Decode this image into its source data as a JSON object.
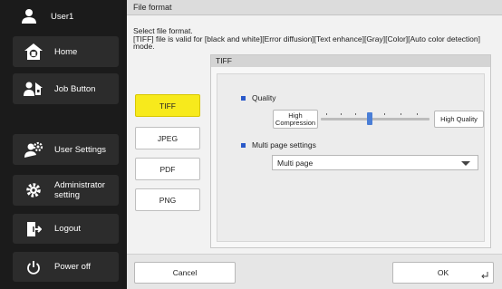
{
  "sidebar": {
    "user": "User1",
    "items": [
      {
        "label": "Home",
        "icon": "home-icon"
      },
      {
        "label": "Job Button",
        "icon": "job-button-icon"
      },
      {
        "label": "User Settings",
        "icon": "user-settings-icon"
      },
      {
        "label": "Administrator setting",
        "icon": "gear-icon"
      },
      {
        "label": "Logout",
        "icon": "logout-icon"
      },
      {
        "label": "Power off",
        "icon": "power-icon"
      }
    ]
  },
  "header": {
    "title": "File format"
  },
  "description": "Select file format.\n[TIFF] file is valid for [black and white][Error diffusion][Text enhance][Gray][Color][Auto color detection] mode.",
  "formats": {
    "options": [
      "TIFF",
      "JPEG",
      "PDF",
      "PNG"
    ],
    "selected": "TIFF"
  },
  "panel": {
    "title": "TIFF",
    "quality": {
      "label": "Quality",
      "low_label": "High Compression",
      "high_label": "High Quality",
      "level_fraction": 0.45
    },
    "multipage": {
      "label": "Multi page settings",
      "selected_value": "Multi page"
    }
  },
  "footer": {
    "cancel_label": "Cancel",
    "ok_label": "OK"
  },
  "colors": {
    "selected_format": "#f7ea1c",
    "accent_blue": "#2a59c9",
    "sidebar_bg": "#1b1b1b"
  }
}
